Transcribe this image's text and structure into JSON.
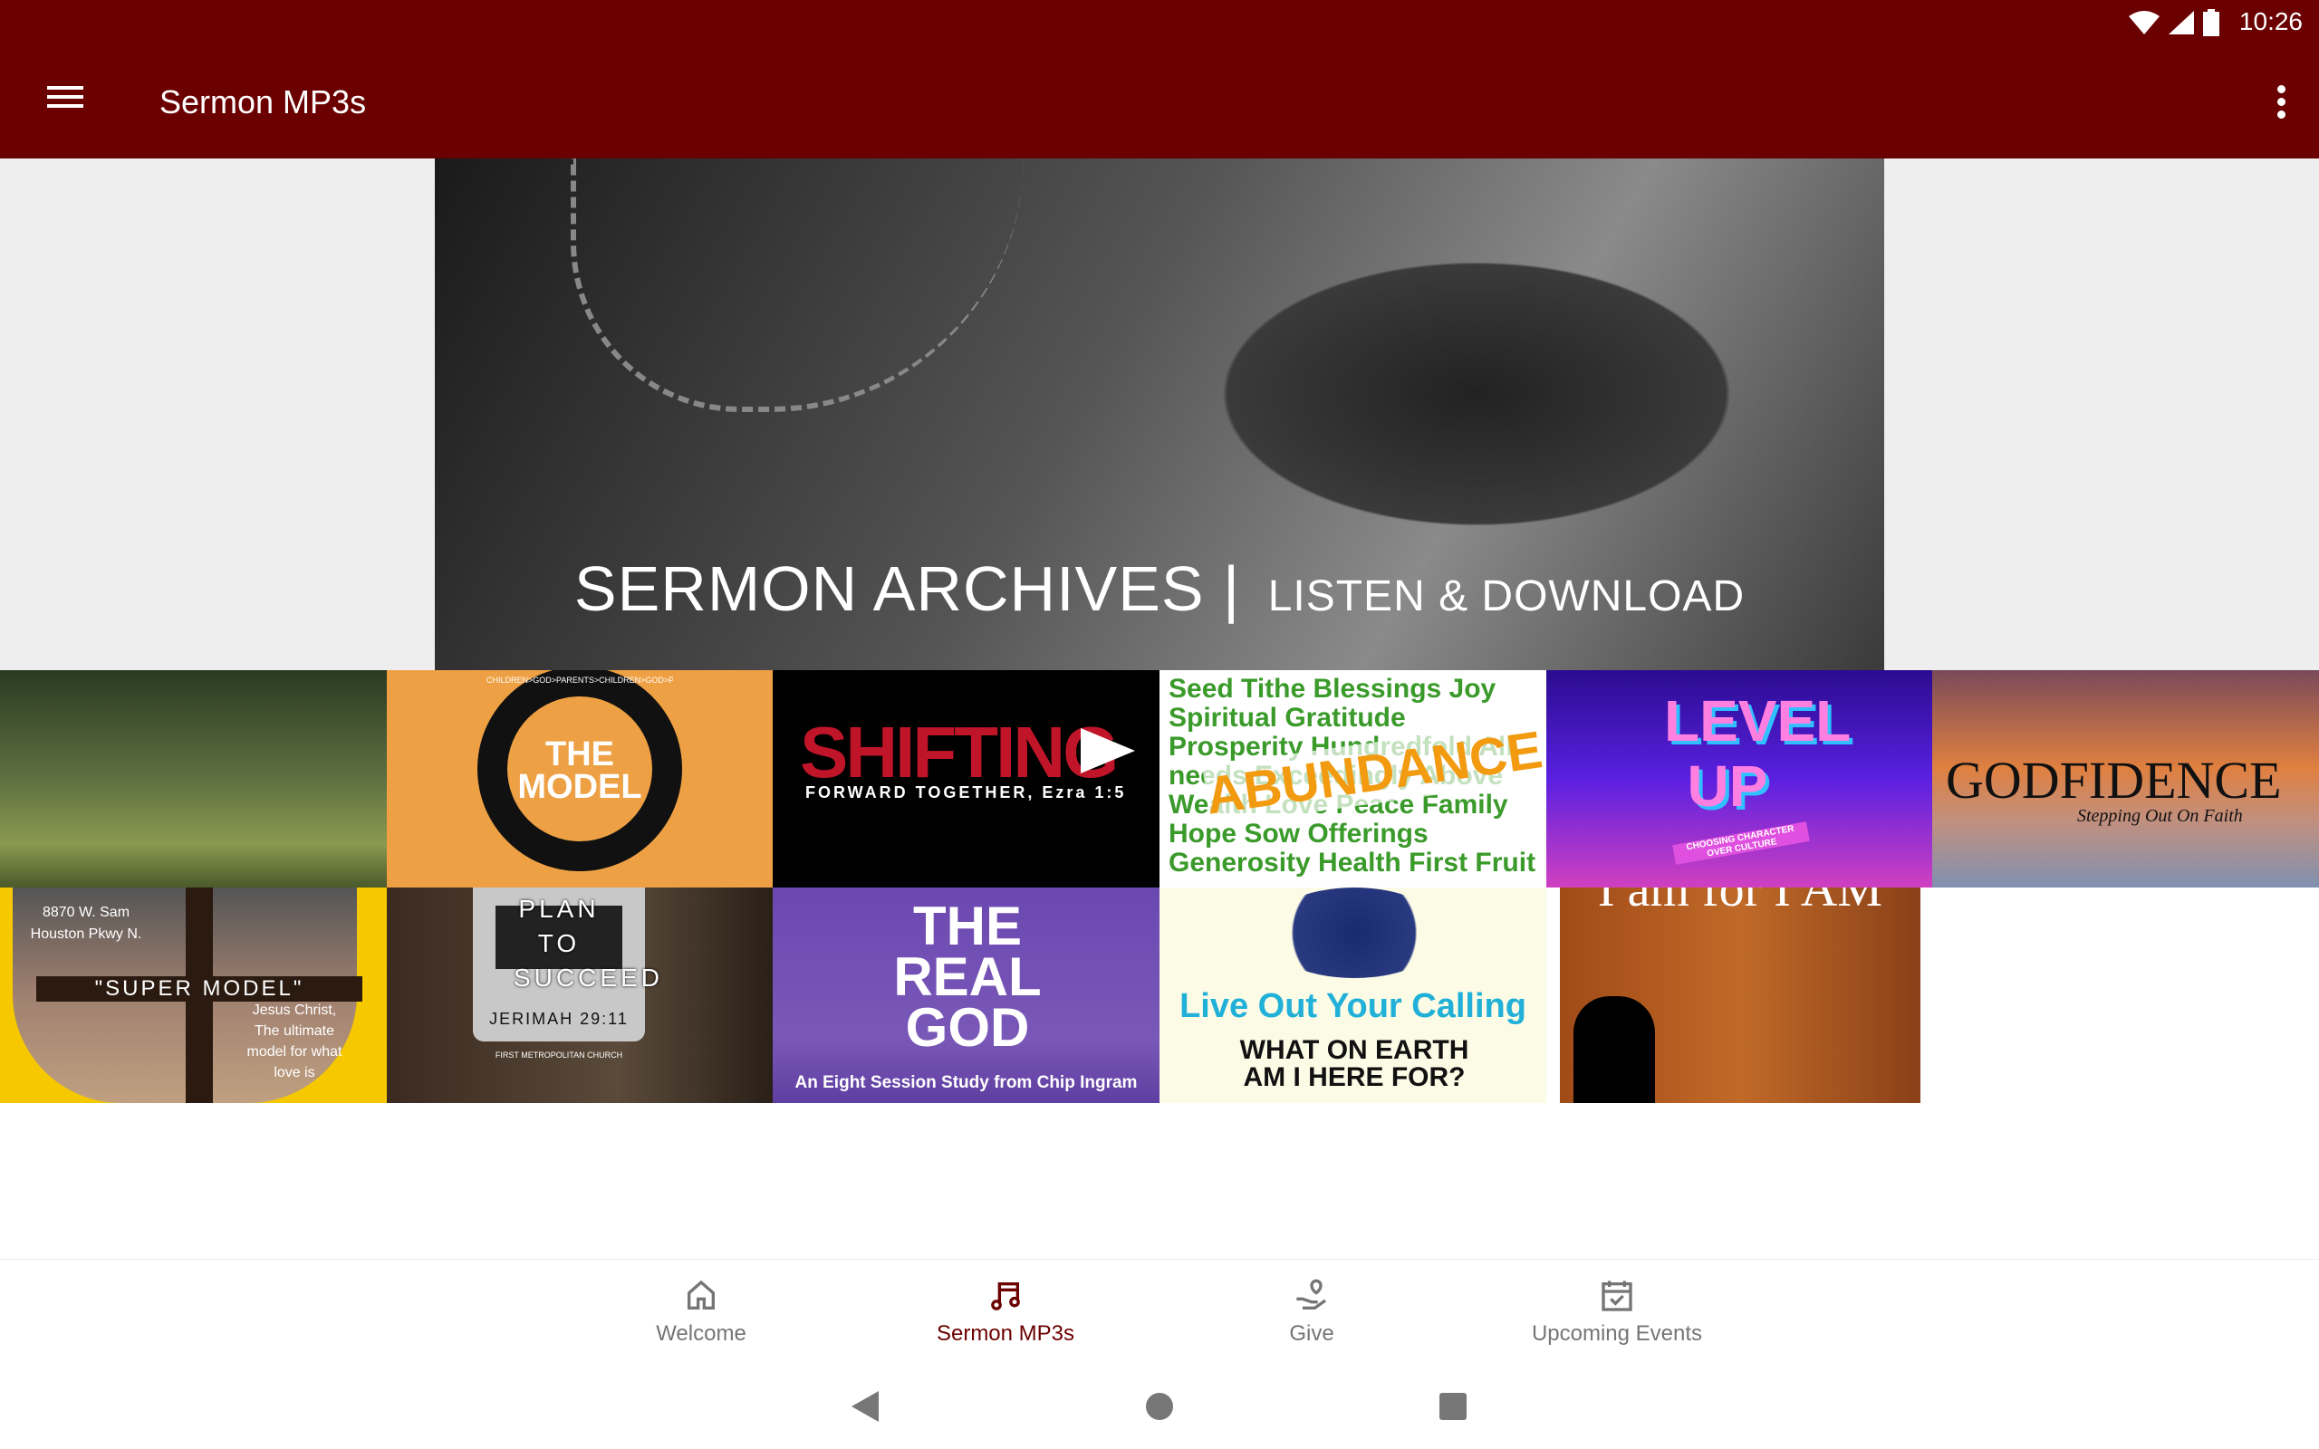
{
  "status_bar": {
    "time": "10:26",
    "icons": [
      "wifi-icon",
      "signal-icon",
      "battery-icon"
    ]
  },
  "app_bar": {
    "title": "Sermon MP3s",
    "menu_icon": "hamburger-icon",
    "overflow_icon": "more-vert-icon"
  },
  "colors": {
    "primary": "#6b0000",
    "inactive": "#757575"
  },
  "banner": {
    "title": "SERMON ARCHIVES",
    "separator": "|",
    "subtitle": "LISTEN & DOWNLOAD"
  },
  "tiles": [
    {
      "title": ""
    },
    {
      "title": "THE MODEL",
      "ring": "CHILDREN>GOD>PARENTS>CHILDREN>GOD>PARENTS"
    },
    {
      "title": "SHIFTING",
      "subtitle": "FORWARD TOGETHER, Ezra 1:5"
    },
    {
      "title": "ABUNDANCE",
      "words": "Seed Tithe Blessings Joy Spiritual Gratitude Prosperity Hundredfold All needs Exceedingly Above Wealth Love Peace Family Hope Sow Offerings Generosity Health First Fruit"
    },
    {
      "title": "LEVEL UP",
      "subtitle": "CHOOSING CHARACTER OVER CULTURE"
    },
    {
      "title": "GODFIDENCE",
      "subtitle": "Stepping Out On Faith"
    },
    {
      "title": "\"SUPER MODEL\"",
      "address": "8870 W. Sam Houston Pkwy N.",
      "caption": "Jesus Christ, The ultimate model for what love is"
    },
    {
      "title": "PLAN TO SUCCEED",
      "subtitle": "JERIMAH 29:11",
      "caption": "FIRST METROPOLITAN CHURCH"
    },
    {
      "title": "THE REAL GOD",
      "subtitle": "An Eight Session Study from Chip Ingram"
    },
    {
      "title": "Live Out Your Calling",
      "subtitle": "WHAT ON EARTH AM I HERE FOR?"
    },
    {
      "title": "I am for I AM"
    }
  ],
  "bottom_nav": [
    {
      "label": "Welcome",
      "icon": "home-icon",
      "active": false
    },
    {
      "label": "Sermon MP3s",
      "icon": "music-note-icon",
      "active": true
    },
    {
      "label": "Give",
      "icon": "give-hand-icon",
      "active": false
    },
    {
      "label": "Upcoming Events",
      "icon": "calendar-check-icon",
      "active": false
    }
  ]
}
